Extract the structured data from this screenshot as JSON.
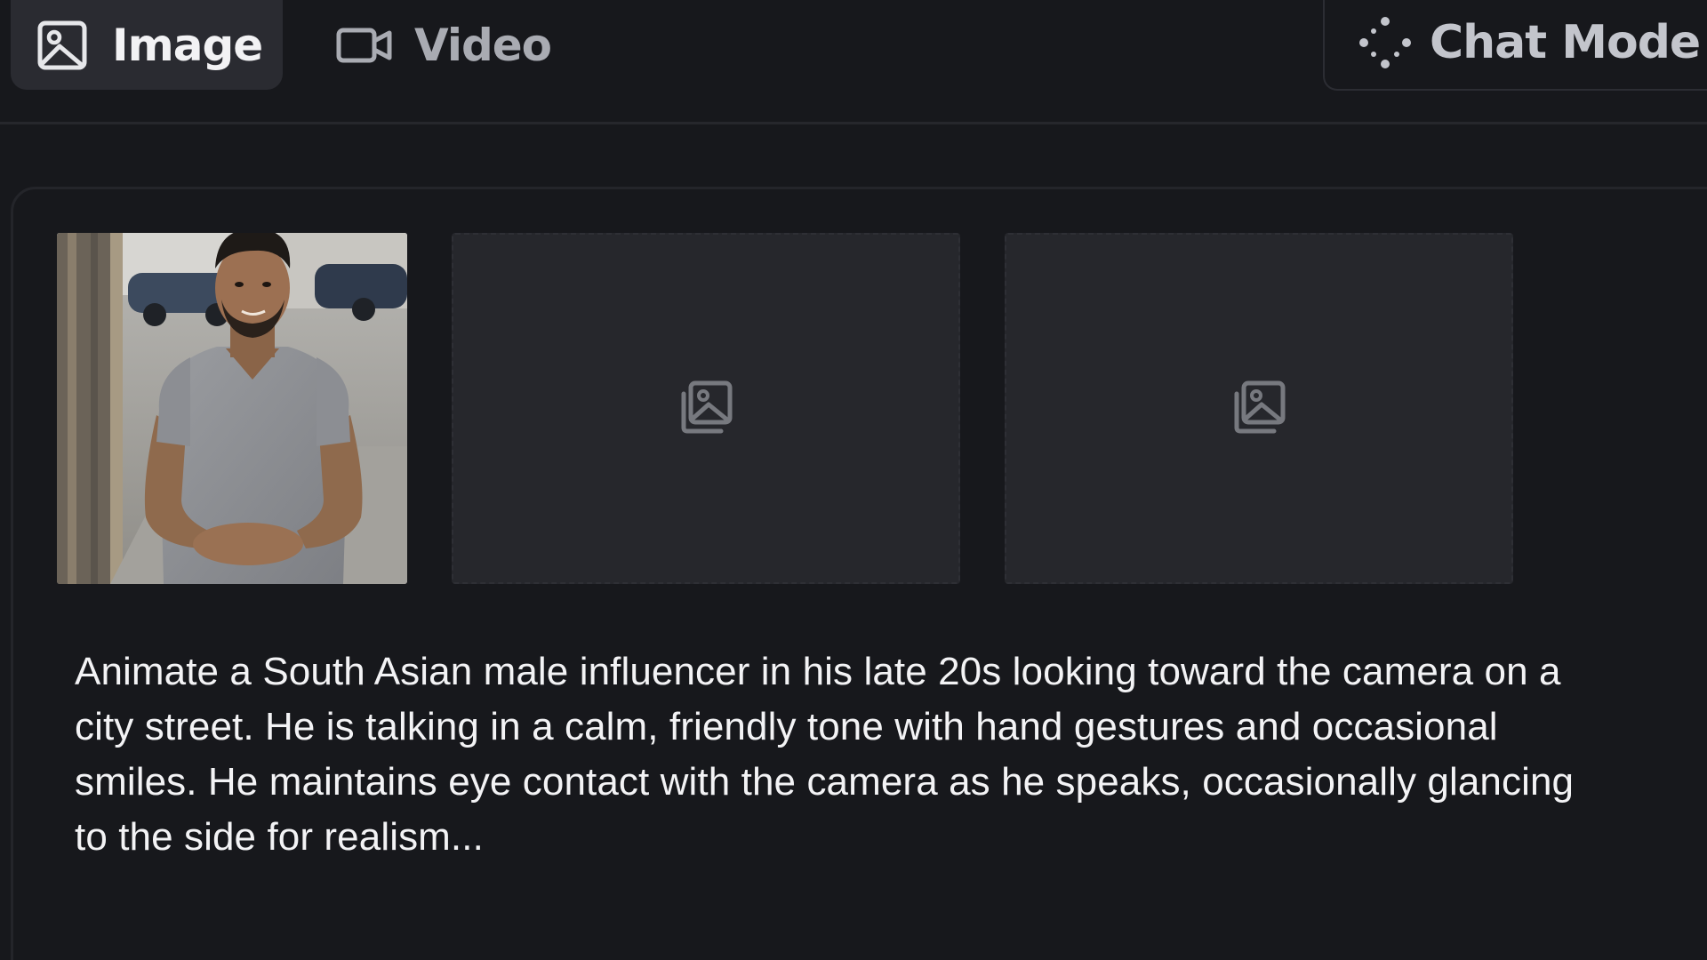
{
  "tabs": {
    "image_label": "Image",
    "video_label": "Video",
    "chat_mode_label": "Chat Mode",
    "active": "Image"
  },
  "icons": {
    "image_tab": "image-icon",
    "video_tab": "video-camera-icon",
    "chat_mode": "sparkle-dots-icon",
    "placeholder": "image-stack-icon"
  },
  "reference_images": {
    "filled_count": 1,
    "empty_slots": 2
  },
  "prompt": {
    "text": "Animate a South Asian male influencer in his late 20s looking toward the camera on a city street. He is talking in a calm, friendly tone with hand gestures and occasional smiles. He maintains eye contact with the camera as he speaks, occasionally glancing to the side for realism..."
  },
  "colors": {
    "background": "#17181c",
    "active_tab_bg": "#2a2b31",
    "slot_bg": "#26272c",
    "text_primary": "#f3f3f5",
    "text_muted": "#a9abb2"
  }
}
